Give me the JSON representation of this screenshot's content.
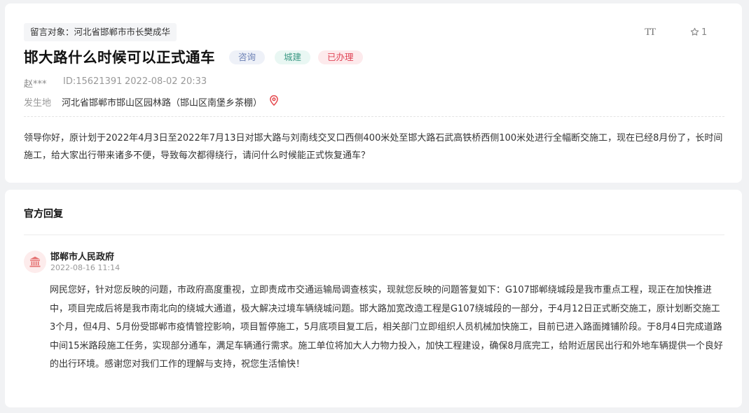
{
  "question": {
    "target": "留言对象：河北省邯郸市市长樊成华",
    "title": "邯大路什么时候可以正式通车",
    "tags": [
      "咨询",
      "城建",
      "已办理"
    ],
    "font_toggle_label": "TT",
    "favorite_count": "1",
    "author": "赵***",
    "message_id": "ID:15621391",
    "time": "2022-08-02 20:33",
    "location_label": "发生地",
    "location": "河北省邯郸市邯山区园林路（邯山区南堡乡茶棚）",
    "body": "领导你好，原计划于2022年4月3日至2022年7月13日对邯大路与刘南线交叉口西侧400米处至邯大路石武高铁桥西侧100米处进行全幅断交施工，现在已经8月份了，长时间施工，给大家出行带来诸多不便，导致每次都得绕行，请问什么时候能正式恢复通车？"
  },
  "reply": {
    "section_title": "官方回复",
    "org": "邯郸市人民政府",
    "time": "2022-08-16 11:14",
    "body": "网民您好，针对您反映的问题，市政府高度重视，立即责成市交通运输局调查核实，现就您反映的问题答复如下：G107邯郸绕城段是我市重点工程，现正在加快推进中，项目完成后将是我市南北向的绕城大通道，极大解决过境车辆绕城问题。邯大路加宽改造工程是G107绕城段的一部分，于4月12日正式断交施工，原计划断交施工3个月，但4月、5月份受邯郸市疫情管控影响，项目暂停施工，5月底项目复工后，相关部门立即组织人员机械加快施工，目前已进入路面摊铺阶段。于8月4日完成道路中间15米路段施工任务，实现部分通车，满足车辆通行需求。施工单位将加大人力物力投入，加快工程建设，确保8月底完工，给附近居民出行和外地车辆提供一个良好的出行环境。感谢您对我们工作的理解与支持，祝您生活愉快！"
  },
  "colors": {
    "consult_tag": "#6a7fb4",
    "construction_tag": "#3d9a85",
    "handled_tag": "#e04557",
    "pin": "#e5484d"
  }
}
